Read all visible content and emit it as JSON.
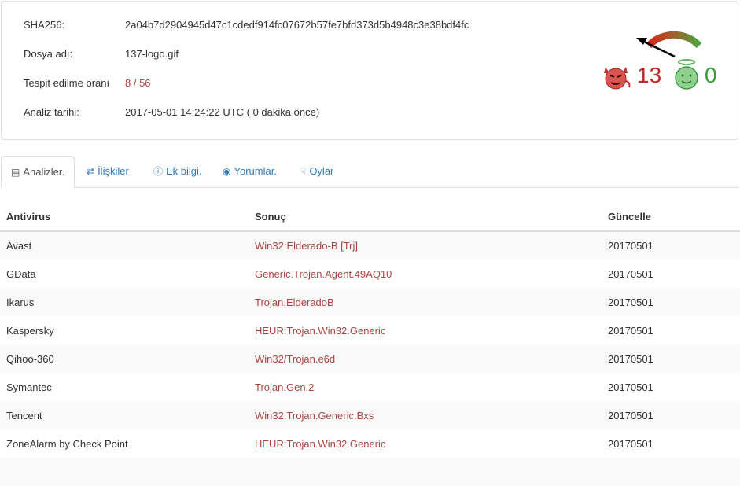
{
  "info": {
    "sha_label": "SHA256:",
    "sha_value": "2a04b7d2904945d47c1cdedf914fc07672b57fe7bfd373d5b4948c3e38bdf4fc",
    "name_label": "Dosya adı:",
    "name_value": "137-logo.gif",
    "rate_label": "Tespit edilme oranı",
    "rate_value": "8 / 56",
    "date_label": "Analiz tarihi:",
    "date_value": "2017-05-01 14:24:22 UTC ( 0 dakika önce)"
  },
  "score": {
    "malicious": "13",
    "harmless": "0",
    "malicious_color": "#b92c28",
    "harmless_color": "#3c9a3c"
  },
  "tabs": [
    {
      "label": "Analizler.",
      "icon": "list-icon"
    },
    {
      "label": "İlişkiler",
      "icon": "shuffle-icon"
    },
    {
      "label": "Ek bilgi.",
      "icon": "info-icon"
    },
    {
      "label": "Yorumlar.",
      "icon": "comment-icon"
    },
    {
      "label": "Oylar",
      "icon": "thumbs-down-icon"
    }
  ],
  "table": {
    "headers": [
      "Antivirus",
      "Sonuç",
      "Güncelle"
    ],
    "rows": [
      [
        "Avast",
        "Win32:Elderado-B [Trj]",
        "20170501"
      ],
      [
        "GData",
        "Generic.Trojan.Agent.49AQ10",
        "20170501"
      ],
      [
        "Ikarus",
        "Trojan.ElderadoB",
        "20170501"
      ],
      [
        "Kaspersky",
        "HEUR:Trojan.Win32.Generic",
        "20170501"
      ],
      [
        "Qihoo-360",
        "Win32/Trojan.e6d",
        "20170501"
      ],
      [
        "Symantec",
        "Trojan.Gen.2",
        "20170501"
      ],
      [
        "Tencent",
        "Win32.Trojan.Generic.Bxs",
        "20170501"
      ],
      [
        "ZoneAlarm by Check Point",
        "HEUR:Trojan.Win32.Generic",
        "20170501"
      ]
    ]
  }
}
